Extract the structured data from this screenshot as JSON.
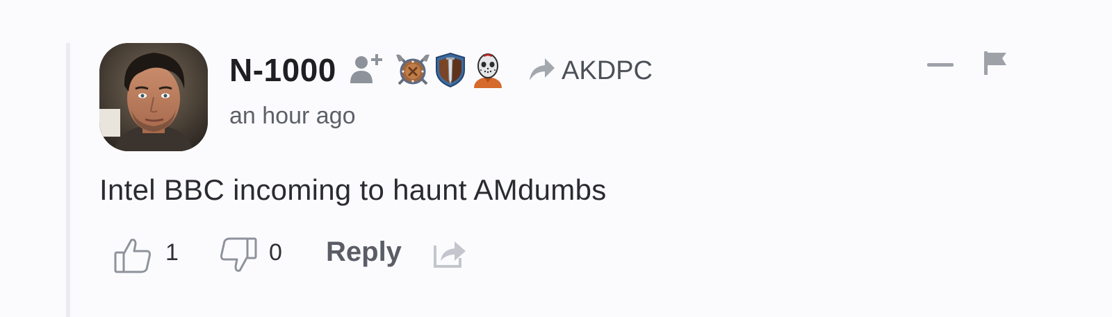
{
  "comment": {
    "username": "N-1000",
    "reply_to": "AKDPC",
    "timestamp": "an hour ago",
    "body": "Intel BBC incoming to haunt AMdumbs",
    "likes": "1",
    "dislikes": "0",
    "reply_label": "Reply"
  },
  "icons": {
    "avatar": "user-avatar-photo",
    "follow": "follow-user-icon",
    "badges": [
      "crossed-axes-shield-badge",
      "sword-shield-badge",
      "hockey-mask-badge"
    ],
    "reply_to": "reply-arrow-icon",
    "collapse": "minus-icon",
    "flag": "flag-icon",
    "like": "thumbs-up-icon",
    "dislike": "thumbs-down-icon",
    "share": "share-icon"
  },
  "colors": {
    "background": "#fbfbfd",
    "text_primary": "#1f1f23",
    "text_secondary": "#5d6068",
    "icon_gray": "#9ea1a8"
  }
}
